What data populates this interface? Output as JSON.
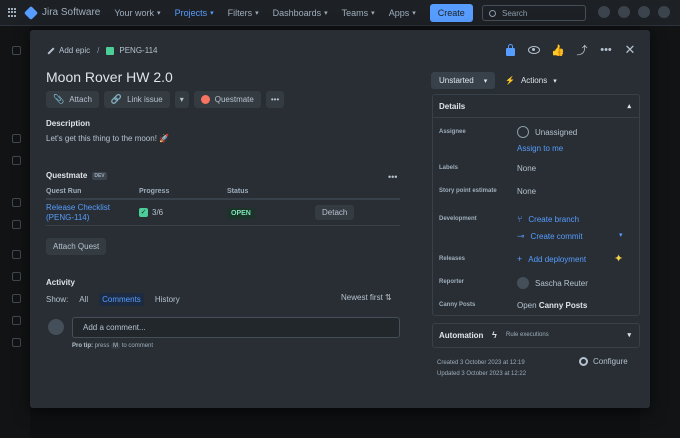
{
  "topnav": {
    "app_name": "Jira Software",
    "items": [
      {
        "label": "Your work",
        "active": false
      },
      {
        "label": "Projects",
        "active": true
      },
      {
        "label": "Filters",
        "active": false
      },
      {
        "label": "Dashboards",
        "active": false
      },
      {
        "label": "Teams",
        "active": false
      },
      {
        "label": "Apps",
        "active": false
      }
    ],
    "create_label": "Create",
    "search_placeholder": "Search"
  },
  "modal": {
    "add_epic_label": "Add epic",
    "issue_key": "PENG-114",
    "title": "Moon Rover HW 2.0",
    "toolbar": {
      "attach": "Attach",
      "link_issue": "Link issue",
      "questmate": "Questmate"
    },
    "description_heading": "Description",
    "description_text": "Let's get this thing to the moon! 🚀",
    "questmate": {
      "heading": "Questmate",
      "badge": "DEV",
      "columns": [
        "Quest Run",
        "Progress",
        "Status"
      ],
      "rows": [
        {
          "quest_run": "Release Checklist (PENG-114)",
          "progress": "3/6",
          "status": "OPEN",
          "action": "Detach"
        }
      ],
      "attach_label": "Attach Quest"
    },
    "activity": {
      "heading": "Activity",
      "show_label": "Show:",
      "filters": [
        {
          "label": "All",
          "active": false
        },
        {
          "label": "Comments",
          "active": true
        },
        {
          "label": "History",
          "active": false
        }
      ],
      "sort_label": "Newest first",
      "comment_placeholder": "Add a comment...",
      "protip_prefix": "Pro tip:",
      "protip_press": "press",
      "protip_key": "M",
      "protip_suffix": "to comment"
    },
    "status": "Unstarted",
    "actions_label": "Actions",
    "details": {
      "heading": "Details",
      "assignee_label": "Assignee",
      "assignee_value": "Unassigned",
      "assign_to_me": "Assign to me",
      "labels_label": "Labels",
      "labels_value": "None",
      "story_points_label": "Story point estimate",
      "story_points_value": "None",
      "development_label": "Development",
      "create_branch": "Create branch",
      "create_commit": "Create commit",
      "releases_label": "Releases",
      "add_deployment": "Add deployment",
      "reporter_label": "Reporter",
      "reporter_value": "Sascha Reuter",
      "canny_label": "Canny Posts",
      "canny_open": "Open",
      "canny_value": "Canny Posts"
    },
    "automation": {
      "heading": "Automation",
      "rule_label": "Rule executions"
    },
    "created": "Created 3 October 2023 at 12:19",
    "updated": "Updated 3 October 2023 at 12:22",
    "configure_label": "Configure"
  },
  "colors": {
    "accent": "#579dff",
    "modal_bg": "#282e33",
    "success": "#4bce97"
  }
}
